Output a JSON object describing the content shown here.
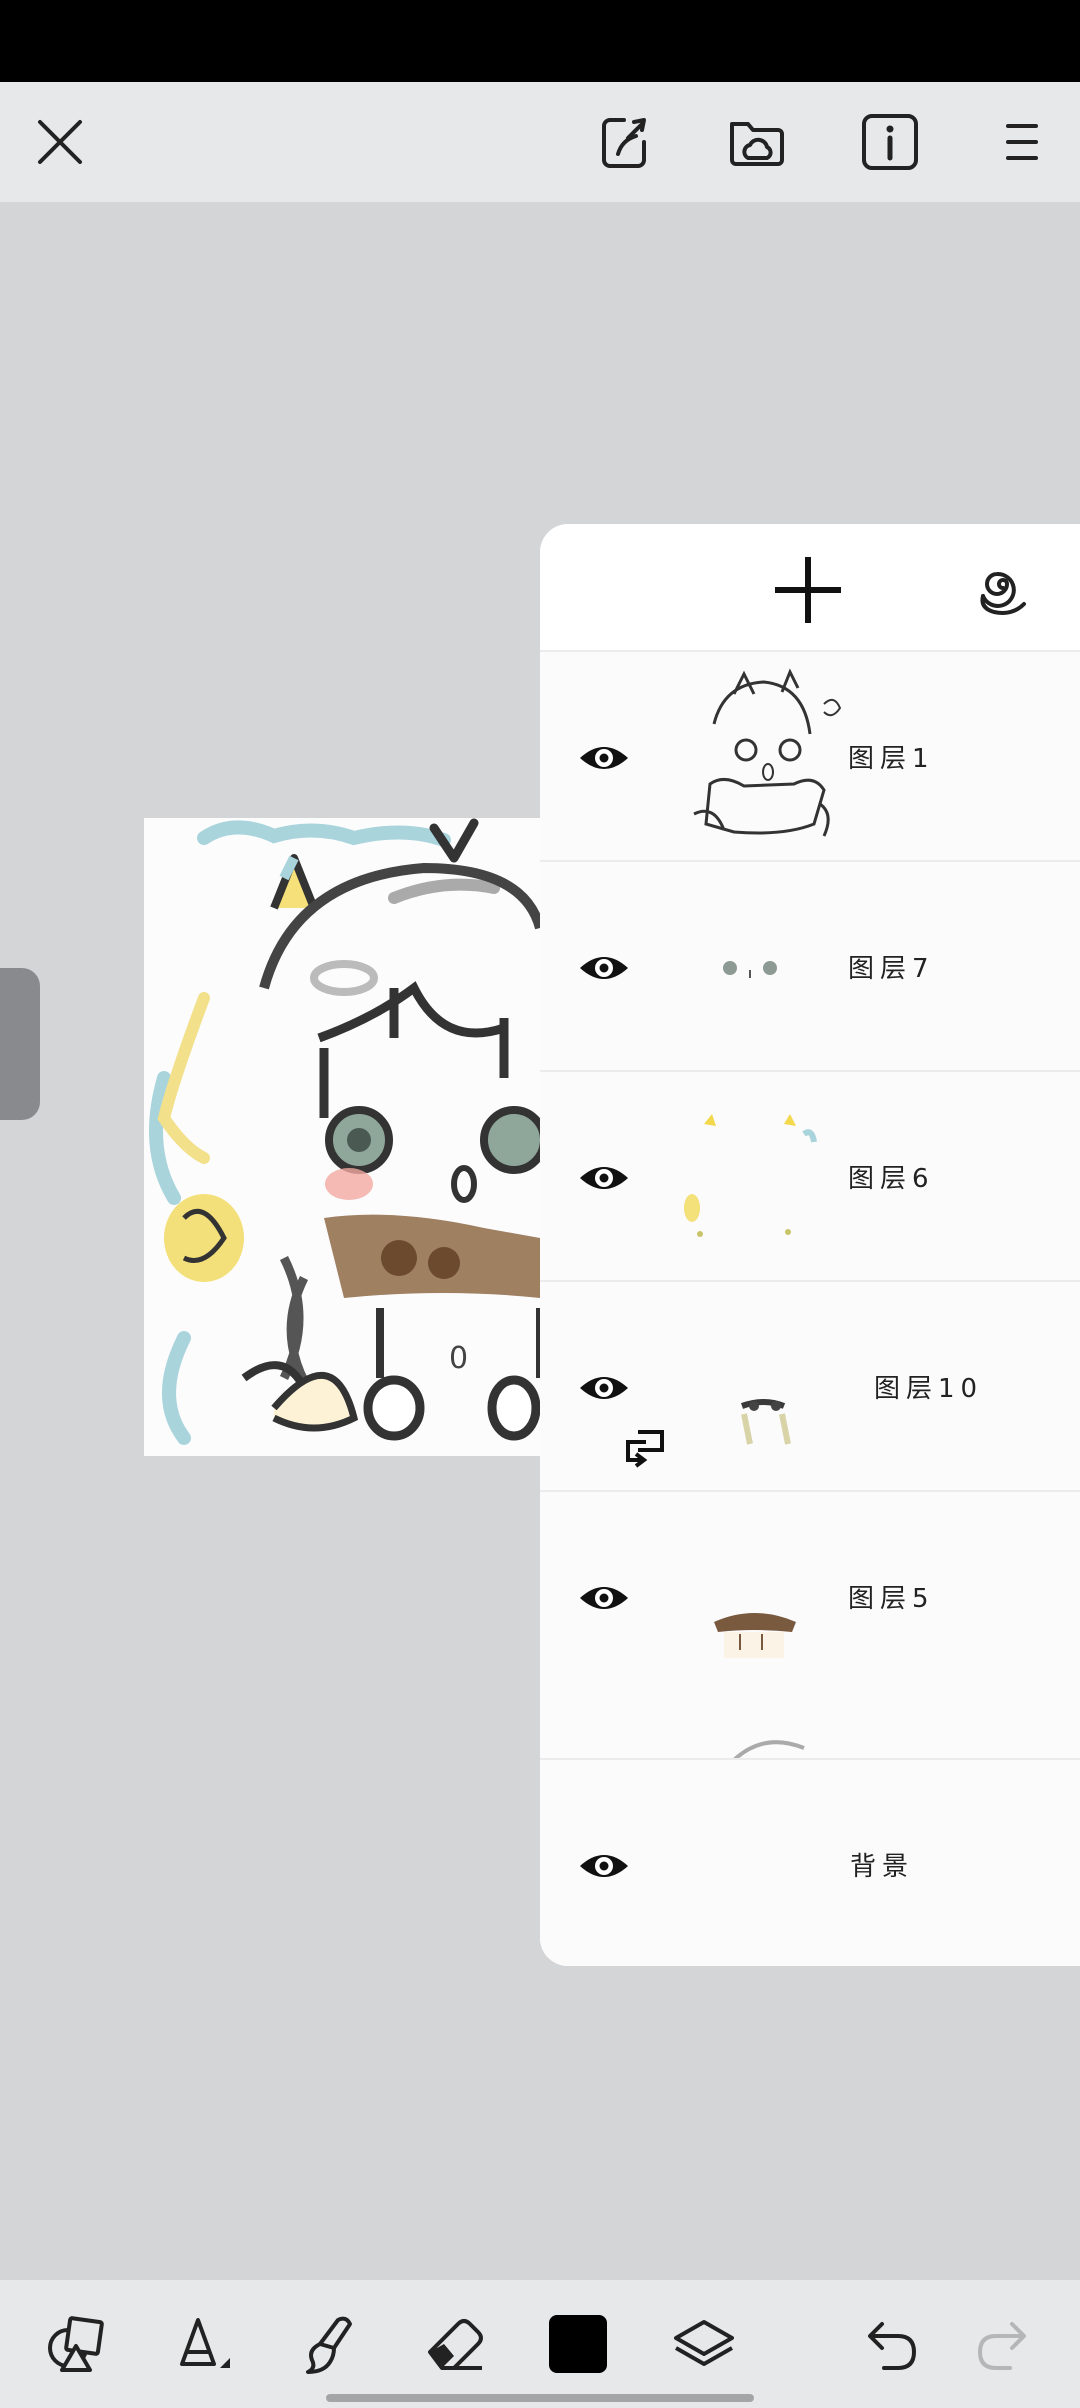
{
  "topbar": {
    "icons": [
      "close-icon",
      "share-export-icon",
      "cloud-folder-icon",
      "info-icon",
      "menu-icon"
    ]
  },
  "colors": {
    "current_color": "#000000",
    "panel_bg": "#ffffff",
    "canvas_bg": "#d4d5d7"
  },
  "layers_panel": {
    "header_icons": [
      "add-layer-icon",
      "spiral-options-icon"
    ],
    "layers": [
      {
        "name": "图层1",
        "visible": true,
        "clipped": false
      },
      {
        "name": "图层7",
        "visible": true,
        "clipped": false
      },
      {
        "name": "图层6",
        "visible": true,
        "clipped": false
      },
      {
        "name": "图层10",
        "visible": true,
        "clipped": true
      },
      {
        "name": "图层5",
        "visible": true,
        "clipped": false
      },
      {
        "name": "背景",
        "visible": true,
        "clipped": false
      }
    ]
  },
  "bottombar": {
    "tools": [
      "shapes-tool-icon",
      "brush-tool-icon",
      "smudge-tool-icon",
      "eraser-tool-icon",
      "color-swatch",
      "layers-icon",
      "undo-icon",
      "redo-icon"
    ]
  }
}
